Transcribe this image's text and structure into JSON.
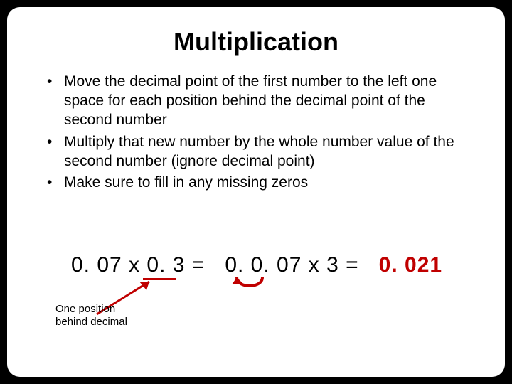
{
  "title": "Multiplication",
  "bullets": [
    "Move the decimal point of the first number to the left one space for each position behind the decimal point of the second number",
    "Multiply that new number by the whole number value of the second number (ignore decimal point)",
    "Make sure to fill in any missing zeros"
  ],
  "equation": {
    "lhs": "0. 07 x 0. 3 =",
    "mid": "0. 0. 07  x 3 =",
    "answer": "0. 021"
  },
  "caption_line1": "One position",
  "caption_line2": "behind decimal"
}
